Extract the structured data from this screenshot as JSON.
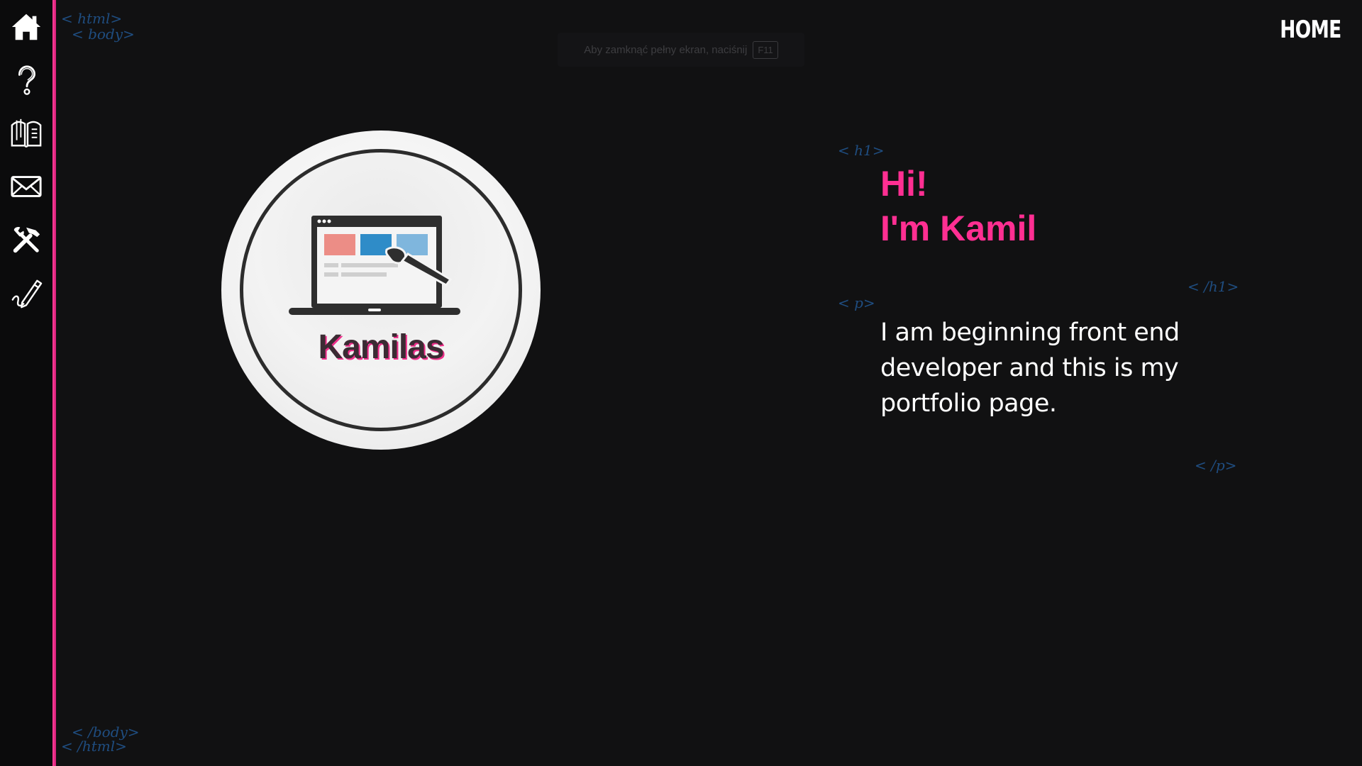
{
  "nav": {
    "items": [
      {
        "name": "home",
        "icon": "home-icon"
      },
      {
        "name": "about",
        "icon": "question-icon"
      },
      {
        "name": "portfolio",
        "icon": "book-icon"
      },
      {
        "name": "contact",
        "icon": "mail-icon"
      },
      {
        "name": "skills",
        "icon": "tools-icon"
      },
      {
        "name": "blog",
        "icon": "pen-icon"
      }
    ],
    "accent_color": "#ff3f9a"
  },
  "fullscreen_notice": {
    "text": "Aby zamknąć pełny ekran, naciśnij",
    "key": "F11"
  },
  "page_label": "HOME",
  "tags": {
    "html_open": "< html>",
    "body_open": "< body>",
    "h1_open": "< h1>",
    "h1_close": "< /h1>",
    "p_open": "< p>",
    "p_close": "< /p>",
    "body_close": "< /body>",
    "html_close": "< /html>"
  },
  "logo": {
    "text": "Kamilas"
  },
  "heading": {
    "line1": "Hi!",
    "line2": "I'm Kamil"
  },
  "intro": "I am beginning front end developer and this is my portfolio page.",
  "colors": {
    "background": "#111112",
    "accent": "#ff2f92",
    "tag": "#1f4d80"
  }
}
